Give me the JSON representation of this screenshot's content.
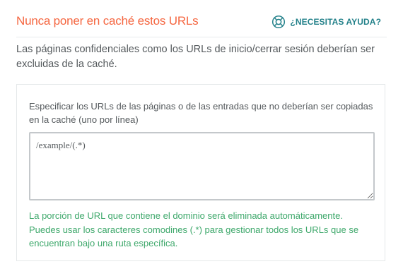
{
  "section": {
    "title": "Nunca poner en caché estos URLs",
    "help_link": {
      "label": "¿NECESITAS AYUDA?",
      "icon": "lifebuoy-icon"
    }
  },
  "description": "Las páginas confidenciales como los URLs de inicio/cerrar sesión deberían ser excluidas de la caché.",
  "field": {
    "label": "Especificar los URLs de las páginas o de las entradas que no deberían ser copiadas en la caché (uno por línea)",
    "value": "/example/(.*)",
    "help_line1": "La porción de URL que contiene el dominio será eliminada automáticamente.",
    "help_line2": "Puedes usar los caracteres comodines (.*) para gestionar todos los URLs que se encuentran bajo una ruta específica."
  },
  "colors": {
    "title": "#f56640",
    "help_link": "#23818a",
    "help_text": "#3ea86b"
  }
}
